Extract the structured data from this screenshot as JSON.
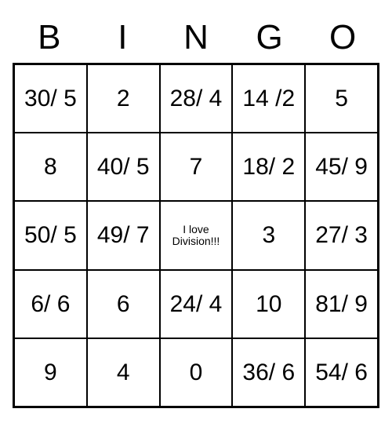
{
  "header": [
    "B",
    "I",
    "N",
    "G",
    "O"
  ],
  "grid": [
    [
      "30/ 5",
      "2",
      "28/ 4",
      "14 /2",
      "5"
    ],
    [
      "8",
      "40/ 5",
      "7",
      "18/ 2",
      "45/ 9"
    ],
    [
      "50/ 5",
      "49/ 7",
      "I love Division!!!",
      "3",
      "27/ 3"
    ],
    [
      "6/ 6",
      "6",
      "24/ 4",
      "10",
      "81/ 9"
    ],
    [
      "9",
      "4",
      "0",
      "36/ 6",
      "54/ 6"
    ]
  ],
  "free_cell": {
    "row": 2,
    "col": 2
  }
}
